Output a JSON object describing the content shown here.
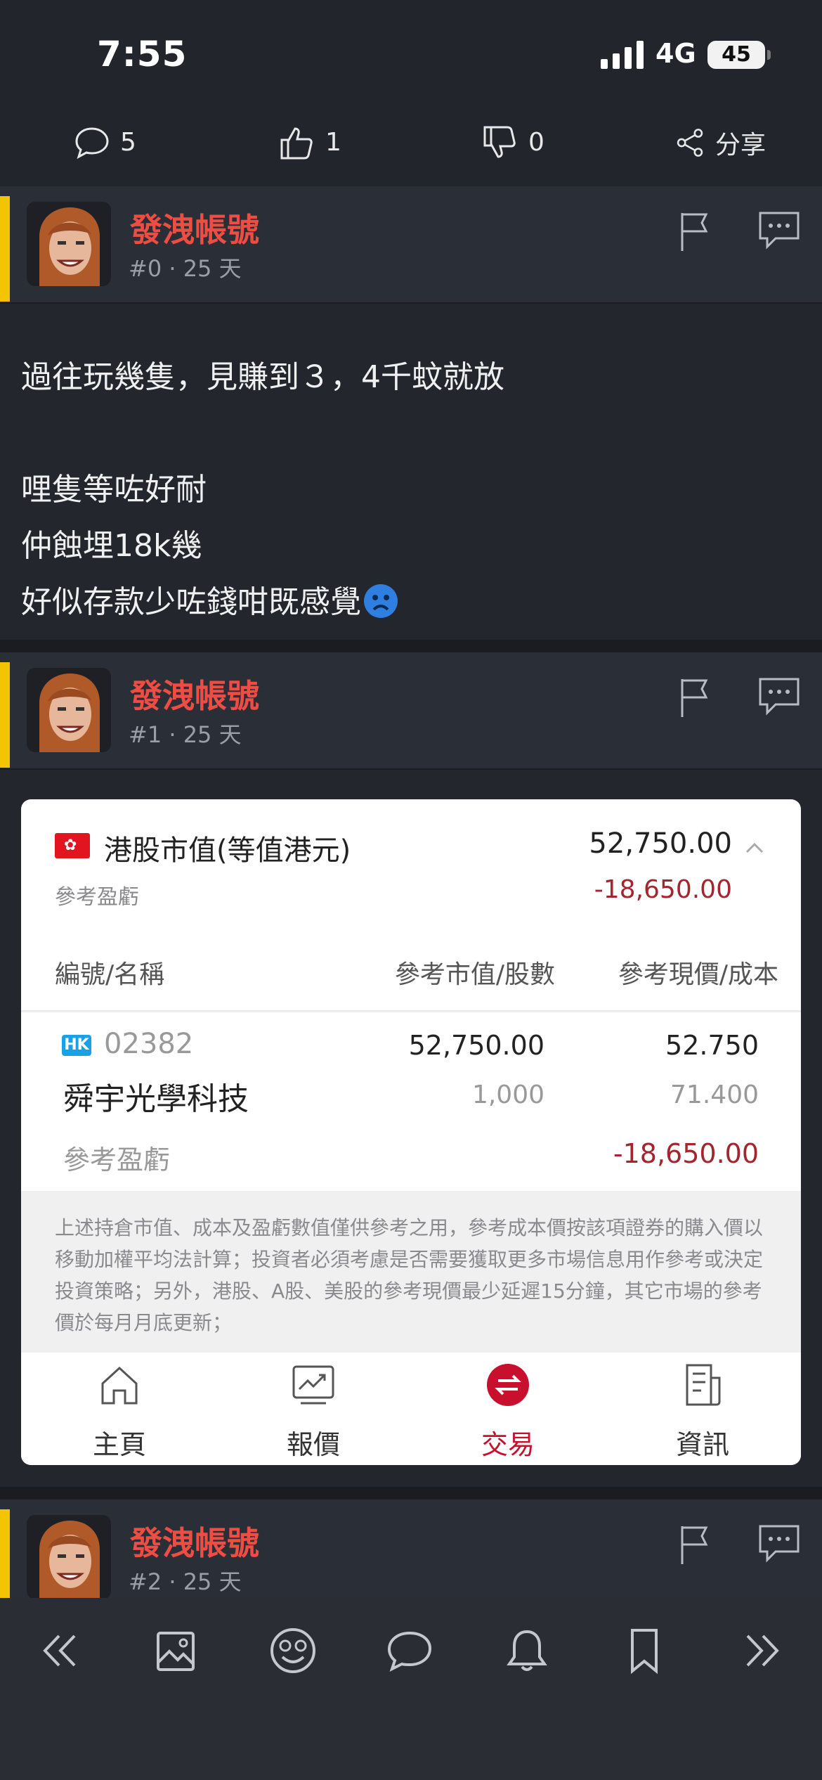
{
  "status": {
    "time": "7:55",
    "network": "4G",
    "battery": "45"
  },
  "actions": {
    "comments": "5",
    "likes": "1",
    "dislikes": "0",
    "share_label": "分享"
  },
  "posts": [
    {
      "username": "發洩帳號",
      "number": "#0",
      "age": "· 25 天",
      "lines": [
        "過往玩幾隻，見賺到３，4千蚊就放",
        "",
        "哩隻等咗好耐",
        "仲蝕埋18k幾",
        "好似存款少咗錢咁既感覺"
      ]
    },
    {
      "username": "發洩帳號",
      "number": "#1",
      "age": "· 25 天"
    },
    {
      "username": "發洩帳號",
      "number": "#2",
      "age": "· 25 天"
    }
  ],
  "portfolio": {
    "title": "港股市值(等值港元)",
    "total_value": "52,750.00",
    "pl_label": "參考盈虧",
    "pl_value": "-18,650.00",
    "col_name": "編號/名稱",
    "col_value": "參考市值/股數",
    "col_price": "參考現價/成本",
    "holding": {
      "market": "HK",
      "code": "02382",
      "name": "舜宇光學科技",
      "market_value": "52,750.00",
      "quantity": "1,000",
      "price": "52.750",
      "cost": "71.400",
      "pl_label": "參考盈虧",
      "pl_value": "-18,650.00"
    },
    "notice": "上述持倉市值、成本及盈虧數值僅供參考之用，參考成本價按該項證券的購入價以移動加權平均法計算；投資者必須考慮是否需要獲取更多市場信息用作參考或決定投資策略；另外，港股、A股、美股的參考現價最少延遲15分鐘，其它市場的參考價於每月月底更新；",
    "tabs": [
      {
        "label": "主頁",
        "icon": "home-icon"
      },
      {
        "label": "報價",
        "icon": "chart-icon"
      },
      {
        "label": "交易",
        "icon": "trade-icon",
        "active": true
      },
      {
        "label": "資訊",
        "icon": "news-icon"
      }
    ],
    "colors": {
      "loss": "#a3262e",
      "active_tab": "#c8102e"
    }
  },
  "bottom_nav": [
    "first-page-icon",
    "image-icon",
    "emoji-icon",
    "reply-icon",
    "bell-icon",
    "bookmark-icon",
    "last-page-icon"
  ]
}
